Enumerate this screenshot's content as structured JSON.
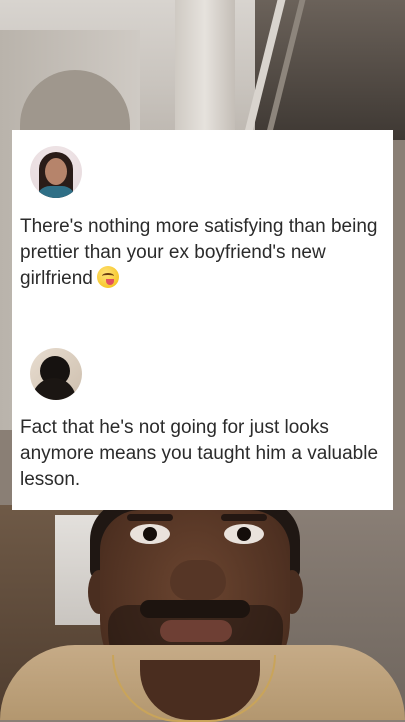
{
  "post_1": {
    "text": "There's nothing more satisfying than being prettier than your ex boyfriend's new girlfriend",
    "emoji": "face-savoring-food-icon"
  },
  "post_2": {
    "text": "Fact that he's not going for just looks anymore means you taught him a valuable lesson."
  },
  "colors": {
    "card_background": "#ffffff",
    "text": "#2b2b2b",
    "shirt": "#c6ab87"
  }
}
